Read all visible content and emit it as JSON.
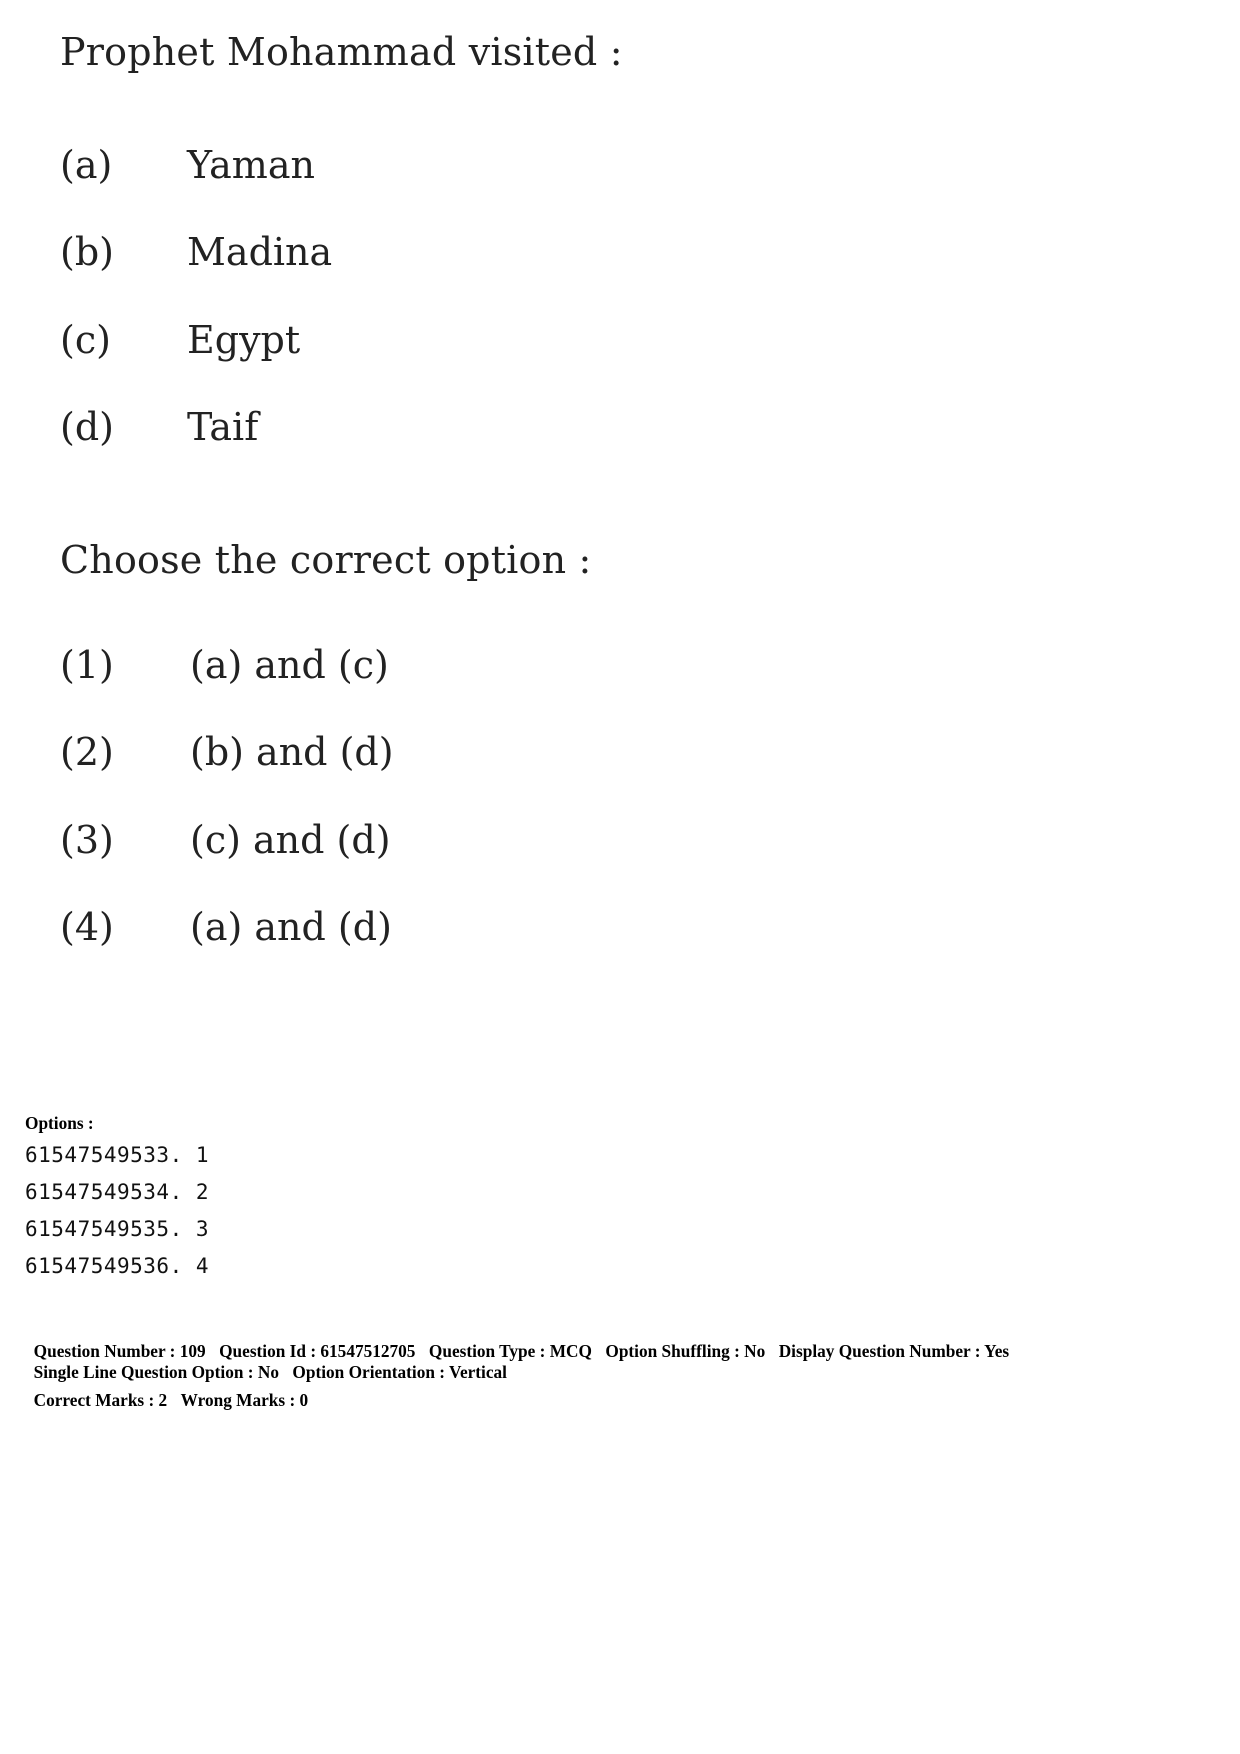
{
  "question": {
    "stem": "Prophet Mohammad visited :",
    "items": [
      {
        "label": "(a)",
        "text": "Yaman"
      },
      {
        "label": "(b)",
        "text": "Madina"
      },
      {
        "label": "(c)",
        "text": "Egypt"
      },
      {
        "label": "(d)",
        "text": "Taif"
      }
    ],
    "instruction": "Choose the correct option :",
    "choices": [
      {
        "label": "(1)",
        "text": "(a) and (c)"
      },
      {
        "label": "(2)",
        "text": "(b) and (d)"
      },
      {
        "label": "(3)",
        "text": "(c) and (d)"
      },
      {
        "label": "(4)",
        "text": "(a) and (d)"
      }
    ]
  },
  "options": {
    "heading": "Options :",
    "rows": [
      "61547549533. 1",
      "61547549534. 2",
      "61547549535. 3",
      "61547549536. 4"
    ]
  },
  "metadata": {
    "line1": [
      "Question Number : 109",
      "Question Id : 61547512705",
      "Question Type : MCQ",
      "Option Shuffling : No",
      "Display Question Number : Yes"
    ],
    "line2": [
      "Single Line Question Option : No",
      "Option Orientation : Vertical"
    ],
    "line3": [
      "Correct Marks : 2",
      "Wrong Marks : 0"
    ]
  }
}
